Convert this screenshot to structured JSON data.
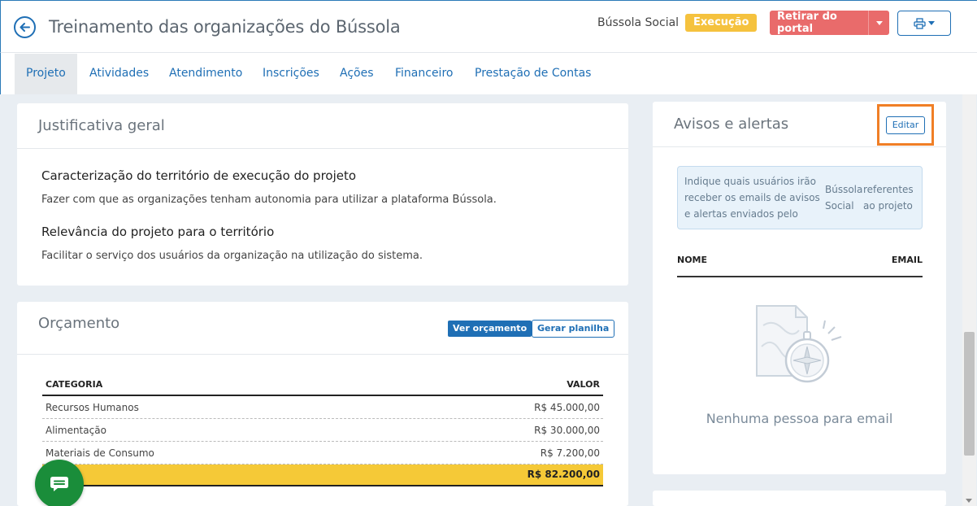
{
  "header": {
    "title": "Treinamento das organizações do Bússola",
    "org_name": "Bússola Social",
    "status": "Execução",
    "portal_button": "Retirar do portal"
  },
  "tabs": [
    {
      "label": "Projeto",
      "active": true
    },
    {
      "label": "Atividades"
    },
    {
      "label": "Atendimento"
    },
    {
      "label": "Inscrições"
    },
    {
      "label": "Ações"
    },
    {
      "label": "Financeiro"
    },
    {
      "label": "Prestação de Contas"
    }
  ],
  "justificativa": {
    "title": "Justificativa geral",
    "sections": [
      {
        "heading": "Caracterização do território de execução do projeto",
        "text": "Fazer com que as organizações tenham autonomia para utilizar a plataforma Bússola."
      },
      {
        "heading": "Relevância do projeto para o território",
        "text": "Facilitar o serviço dos usuários da organização na utilização do sistema."
      }
    ]
  },
  "orcamento": {
    "title": "Orçamento",
    "ver_button": "Ver orçamento",
    "gerar_button": "Gerar planilha",
    "columns": {
      "category": "CATEGORIA",
      "value": "VALOR"
    },
    "rows": [
      {
        "category": "Recursos Humanos",
        "value": "R$ 45.000,00"
      },
      {
        "category": "Alimentação",
        "value": "R$ 30.000,00"
      },
      {
        "category": "Materiais de Consumo",
        "value": "R$ 7.200,00"
      }
    ],
    "total": "R$ 82.200,00"
  },
  "avisos": {
    "title": "Avisos e alertas",
    "edit_button": "Editar",
    "info": {
      "col1": [
        "Indique quais usuários irão",
        "receber os emails de avisos",
        "e alertas enviados pelo"
      ],
      "col2": [
        "Bússola",
        "Social"
      ],
      "col3": [
        "referentes",
        "ao projeto"
      ]
    },
    "columns": {
      "name": "NOME",
      "email": "EMAIL"
    },
    "empty_text": "Nenhuma pessoa para email"
  },
  "colors": {
    "primary": "#1f6fb5",
    "status_badge": "#f5c23e",
    "portal_button": "#e96b6b",
    "highlight": "#f07f26",
    "total_row": "#f5c937",
    "chat": "#1a8d3a"
  }
}
